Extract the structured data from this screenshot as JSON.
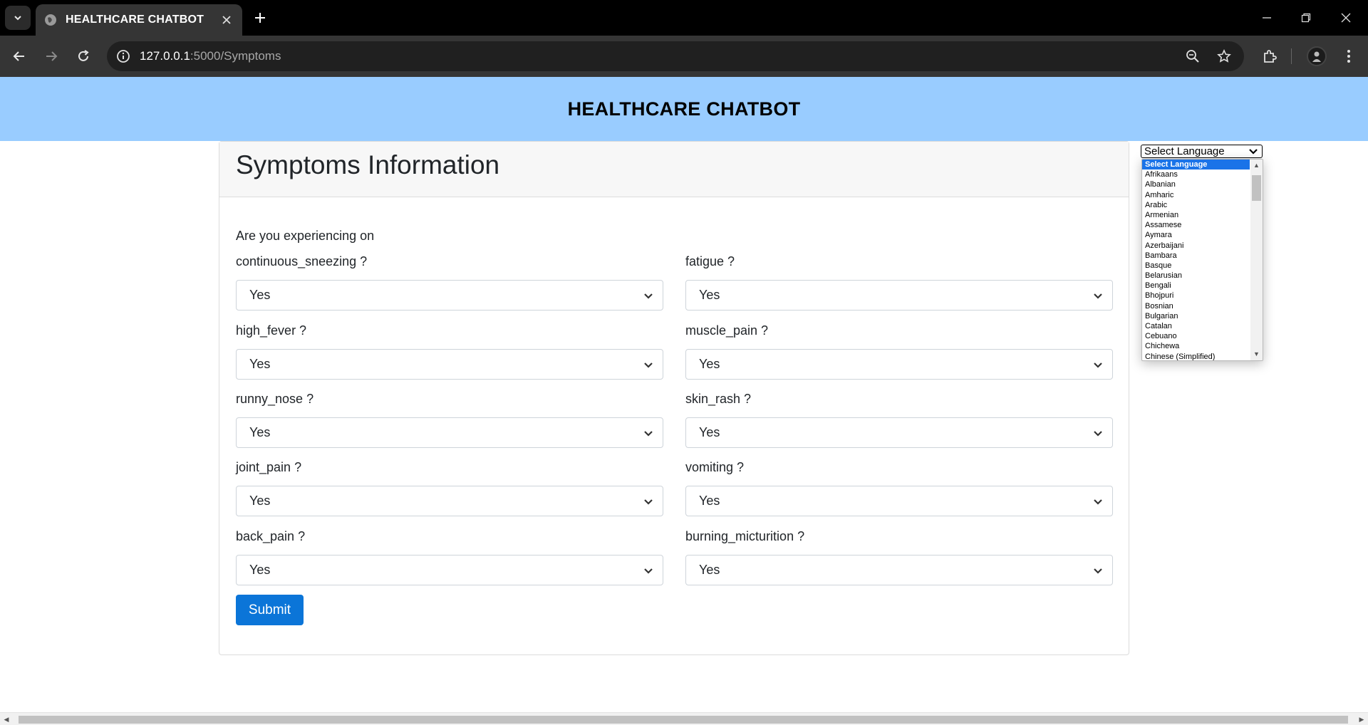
{
  "browser": {
    "tab_title": "HEALTHCARE CHATBOT",
    "url_host": "127.0.0.1",
    "url_path": ":5000/Symptoms"
  },
  "page": {
    "header_title": "HEALTHCARE CHATBOT",
    "card_title": "Symptoms Information",
    "intro": "Are you experiencing on",
    "submit_label": "Submit"
  },
  "symptoms": [
    {
      "label": "continuous_sneezing ?",
      "value": "Yes"
    },
    {
      "label": "fatigue ?",
      "value": "Yes"
    },
    {
      "label": "high_fever ?",
      "value": "Yes"
    },
    {
      "label": "muscle_pain ?",
      "value": "Yes"
    },
    {
      "label": "runny_nose ?",
      "value": "Yes"
    },
    {
      "label": "skin_rash ?",
      "value": "Yes"
    },
    {
      "label": "joint_pain ?",
      "value": "Yes"
    },
    {
      "label": "vomiting ?",
      "value": "Yes"
    },
    {
      "label": "back_pain ?",
      "value": "Yes"
    },
    {
      "label": "burning_micturition ?",
      "value": "Yes"
    }
  ],
  "language": {
    "selected": "Select Language",
    "options": [
      "Select Language",
      "Afrikaans",
      "Albanian",
      "Amharic",
      "Arabic",
      "Armenian",
      "Assamese",
      "Aymara",
      "Azerbaijani",
      "Bambara",
      "Basque",
      "Belarusian",
      "Bengali",
      "Bhojpuri",
      "Bosnian",
      "Bulgarian",
      "Catalan",
      "Cebuano",
      "Chichewa",
      "Chinese (Simplified)"
    ]
  },
  "colors": {
    "header_band": "#99ccff",
    "submit_button": "#0b75d8",
    "selected_option": "#1a73e8"
  }
}
